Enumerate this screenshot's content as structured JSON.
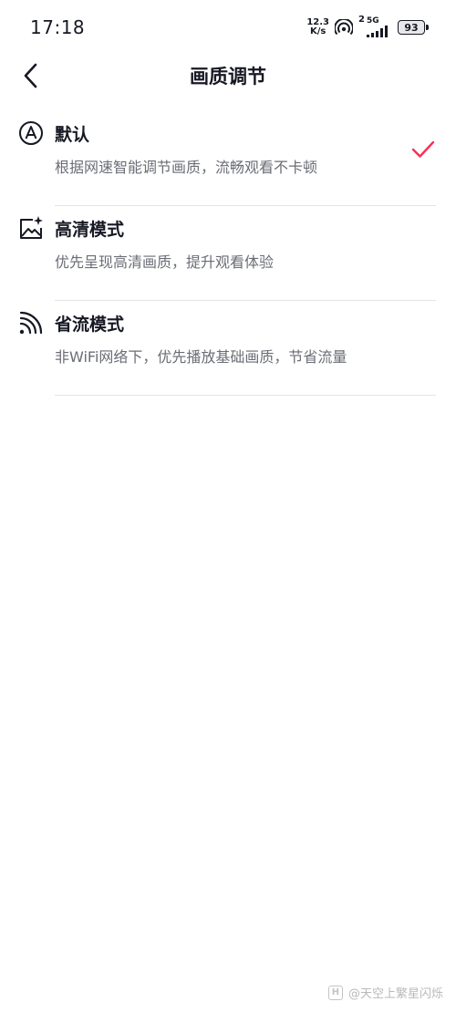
{
  "status_bar": {
    "time": "17:18",
    "net_speed_value": "12.3",
    "net_speed_unit": "K/s",
    "sim_slot": "2",
    "network_type": "5G",
    "battery_level": "93"
  },
  "header": {
    "title": "画质调节"
  },
  "options": [
    {
      "title": "默认",
      "description": "根据网速智能调节画质，流畅观看不卡顿",
      "icon": "auto-a-icon",
      "selected": true
    },
    {
      "title": "高清模式",
      "description": "优先呈现高清画质，提升观看体验",
      "icon": "hd-image-sparkle-icon",
      "selected": false
    },
    {
      "title": "省流模式",
      "description": "非WiFi网络下，优先播放基础画质，节省流量",
      "icon": "signal-waves-icon",
      "selected": false
    }
  ],
  "colors": {
    "accent": "#fe2c55",
    "text_primary": "#161823",
    "text_secondary": "#6b6d75",
    "divider": "#e4e4e6"
  },
  "watermark": {
    "logo_text": "H",
    "text": "@天空上繁星闪烁"
  }
}
